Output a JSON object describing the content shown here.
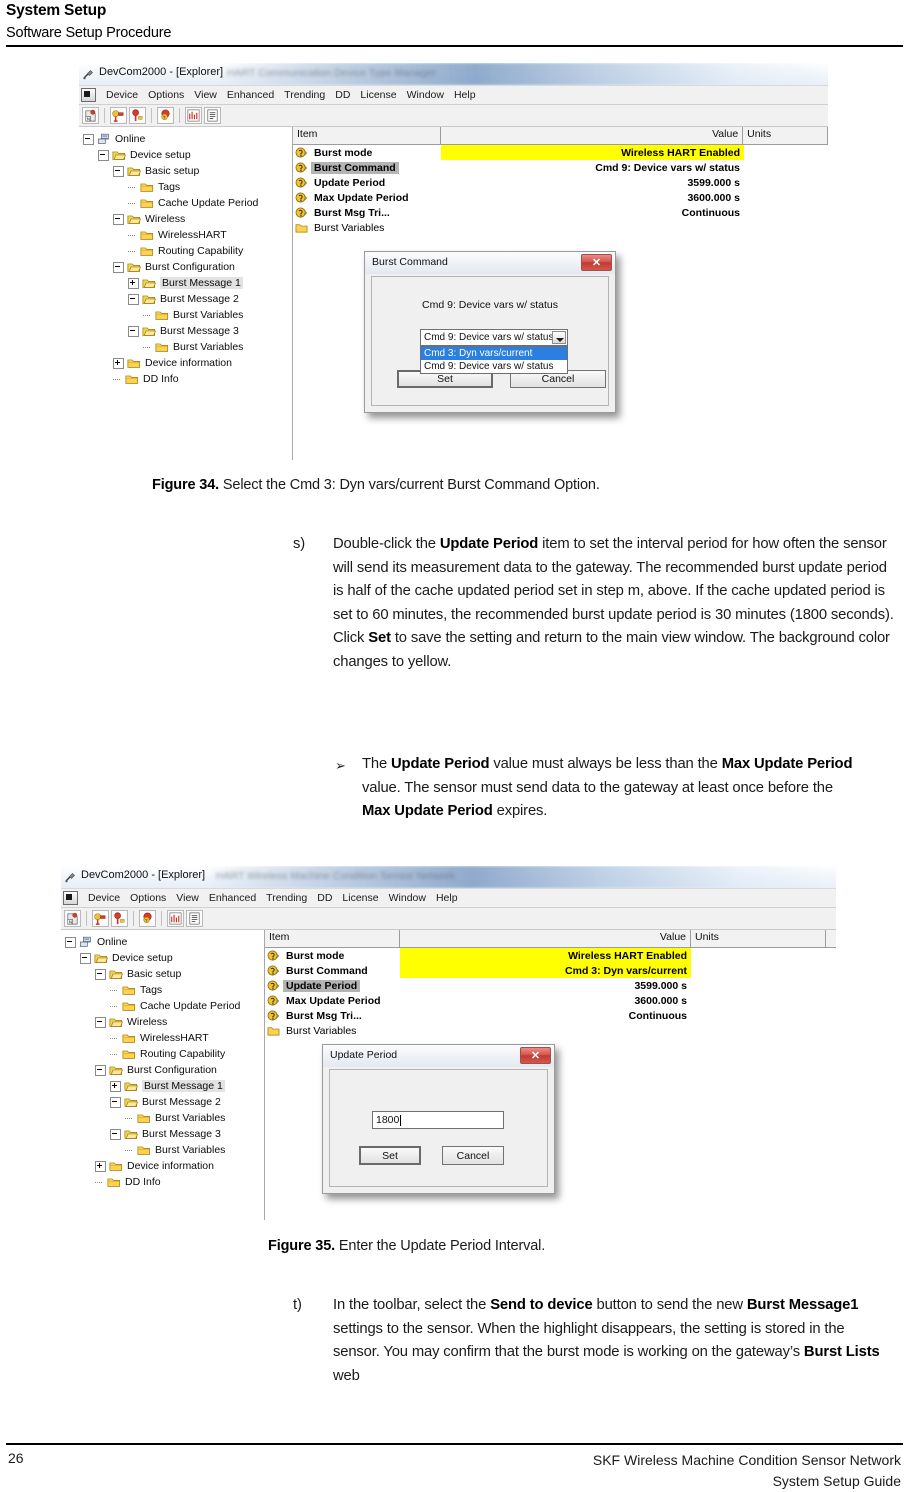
{
  "page_header": {
    "title": "System Setup",
    "subtitle": "Software Setup Procedure"
  },
  "figure34": {
    "window": {
      "title": "DevCom2000 - [Explorer]",
      "title_ghost": "HART Communication Device Type Manager",
      "menu": [
        "Device",
        "Options",
        "View",
        "Enhanced",
        "Trending",
        "DD",
        "License",
        "Window",
        "Help"
      ],
      "toolbar_icons": [
        "save-to-file-icon",
        "send-to-device-icon",
        "receive-from-device-icon",
        "device-status-icon",
        "chart-icon",
        "document-icon"
      ]
    },
    "tree": [
      {
        "label": "Online",
        "depth": 0,
        "toggle": "minus",
        "icon": "network-icon",
        "selected": false
      },
      {
        "label": "Device setup",
        "depth": 1,
        "toggle": "minus",
        "icon": "folder-open-icon",
        "selected": false
      },
      {
        "label": "Basic setup",
        "depth": 2,
        "toggle": "minus",
        "icon": "folder-open-icon",
        "selected": false
      },
      {
        "label": "Tags",
        "depth": 3,
        "toggle": "none",
        "icon": "folder-icon",
        "selected": false
      },
      {
        "label": "Cache Update Period",
        "depth": 3,
        "toggle": "none",
        "icon": "folder-icon",
        "selected": false
      },
      {
        "label": "Wireless",
        "depth": 2,
        "toggle": "minus",
        "icon": "folder-open-icon",
        "selected": false
      },
      {
        "label": "WirelessHART",
        "depth": 3,
        "toggle": "none",
        "icon": "folder-icon",
        "selected": false
      },
      {
        "label": "Routing Capability",
        "depth": 3,
        "toggle": "none",
        "icon": "folder-icon",
        "selected": false
      },
      {
        "label": "Burst Configuration",
        "depth": 2,
        "toggle": "minus",
        "icon": "folder-open-icon",
        "selected": false
      },
      {
        "label": "Burst Message 1",
        "depth": 3,
        "toggle": "plus",
        "icon": "folder-open-icon",
        "selected": true
      },
      {
        "label": "Burst Message 2",
        "depth": 3,
        "toggle": "minus",
        "icon": "folder-open-icon",
        "selected": false
      },
      {
        "label": "Burst Variables",
        "depth": 4,
        "toggle": "none",
        "icon": "folder-icon",
        "selected": false
      },
      {
        "label": "Burst Message 3",
        "depth": 3,
        "toggle": "minus",
        "icon": "folder-open-icon",
        "selected": false
      },
      {
        "label": "Burst Variables",
        "depth": 4,
        "toggle": "none",
        "icon": "folder-icon",
        "selected": false
      },
      {
        "label": "Device information",
        "depth": 2,
        "toggle": "plus",
        "icon": "folder-icon",
        "selected": false
      },
      {
        "label": "DD Info",
        "depth": 2,
        "toggle": "none",
        "icon": "folder-icon",
        "selected": false
      }
    ],
    "grid": {
      "columns": [
        "Item",
        "",
        "Value",
        "Units"
      ],
      "rows": [
        {
          "item": "Burst mode",
          "value": "Wireless HART Enabled",
          "units": "",
          "value_highlight": true,
          "item_selected": false,
          "icon": "variable-icon",
          "bold": true
        },
        {
          "item": "Burst Command",
          "value": "Cmd 9: Device vars w/ status",
          "units": "",
          "value_highlight": false,
          "item_selected": true,
          "icon": "variable-icon",
          "bold": true
        },
        {
          "item": "Update Period",
          "value": "3599.000 s",
          "units": "",
          "value_highlight": false,
          "item_selected": false,
          "icon": "variable-icon",
          "bold": true
        },
        {
          "item": "Max Update Period",
          "value": "3600.000 s",
          "units": "",
          "value_highlight": false,
          "item_selected": false,
          "icon": "variable-icon",
          "bold": true
        },
        {
          "item": "Burst Msg Tri...",
          "value": "Continuous",
          "units": "",
          "value_highlight": false,
          "item_selected": false,
          "icon": "variable-icon",
          "bold": true
        },
        {
          "item": "Burst Variables",
          "value": "",
          "units": "",
          "value_highlight": false,
          "item_selected": false,
          "icon": "folder-icon",
          "bold": false
        }
      ]
    },
    "dialog": {
      "title": "Burst Command",
      "close_label": "✕",
      "caption": "Cmd 9: Device vars w/ status",
      "combo_value": "Cmd 9: Device vars w/ status",
      "options": [
        {
          "label": "Cmd 3: Dyn vars/current",
          "highlighted": true
        },
        {
          "label": "Cmd 9: Device vars w/ status",
          "highlighted": false
        }
      ],
      "set_label": "Set",
      "cancel_label": "Cancel"
    },
    "caption_number": "Figure 34.",
    "caption_text": "Select the Cmd 3: Dyn vars/current Burst Command Option."
  },
  "step_s": {
    "marker": "s)",
    "segments": [
      {
        "t": "Double-click the ",
        "b": false
      },
      {
        "t": "Update Period",
        "b": true
      },
      {
        "t": " item to set the interval period for how often the sensor will send its measurement data to the gateway.  The recommended burst update period is half of the cache updated period set in step m, above.  If the cache updated period is set to 60 minutes, the recommended burst update period is 30 minutes (1800 seconds).  Click ",
        "b": false
      },
      {
        "t": "Set",
        "b": true
      },
      {
        "t": " to save the setting and return to the main view window.  The background color changes to yellow.",
        "b": false
      }
    ]
  },
  "step_s_note": {
    "bullet": "➢",
    "segments": [
      {
        "t": "The ",
        "b": false
      },
      {
        "t": "Update Period",
        "b": true
      },
      {
        "t": " value must always be less than the ",
        "b": false
      },
      {
        "t": "Max Update Period",
        "b": true
      },
      {
        "t": " value.  The sensor must send data to the gateway at least once before the ",
        "b": false
      },
      {
        "t": "Max Update Period",
        "b": true
      },
      {
        "t": " expires.",
        "b": false
      }
    ]
  },
  "figure35": {
    "window": {
      "title": "DevCom2000 - [Explorer]",
      "title_ghost": "HART Wireless Machine Condition Sensor Network",
      "menu": [
        "Device",
        "Options",
        "View",
        "Enhanced",
        "Trending",
        "DD",
        "License",
        "Window",
        "Help"
      ],
      "toolbar_icons": [
        "save-to-file-icon",
        "send-to-device-icon",
        "receive-from-device-icon",
        "device-status-icon",
        "chart-icon",
        "document-icon"
      ]
    },
    "tree": [
      {
        "label": "Online",
        "depth": 0,
        "toggle": "minus",
        "icon": "network-icon",
        "selected": false
      },
      {
        "label": "Device setup",
        "depth": 1,
        "toggle": "minus",
        "icon": "folder-open-icon",
        "selected": false
      },
      {
        "label": "Basic setup",
        "depth": 2,
        "toggle": "minus",
        "icon": "folder-open-icon",
        "selected": false
      },
      {
        "label": "Tags",
        "depth": 3,
        "toggle": "none",
        "icon": "folder-icon",
        "selected": false
      },
      {
        "label": "Cache Update Period",
        "depth": 3,
        "toggle": "none",
        "icon": "folder-icon",
        "selected": false
      },
      {
        "label": "Wireless",
        "depth": 2,
        "toggle": "minus",
        "icon": "folder-open-icon",
        "selected": false
      },
      {
        "label": "WirelessHART",
        "depth": 3,
        "toggle": "none",
        "icon": "folder-icon",
        "selected": false
      },
      {
        "label": "Routing Capability",
        "depth": 3,
        "toggle": "none",
        "icon": "folder-icon",
        "selected": false
      },
      {
        "label": "Burst Configuration",
        "depth": 2,
        "toggle": "minus",
        "icon": "folder-open-icon",
        "selected": false
      },
      {
        "label": "Burst Message 1",
        "depth": 3,
        "toggle": "plus",
        "icon": "folder-open-icon",
        "selected": true
      },
      {
        "label": "Burst Message 2",
        "depth": 3,
        "toggle": "minus",
        "icon": "folder-open-icon",
        "selected": false
      },
      {
        "label": "Burst Variables",
        "depth": 4,
        "toggle": "none",
        "icon": "folder-icon",
        "selected": false
      },
      {
        "label": "Burst Message 3",
        "depth": 3,
        "toggle": "minus",
        "icon": "folder-open-icon",
        "selected": false
      },
      {
        "label": "Burst Variables",
        "depth": 4,
        "toggle": "none",
        "icon": "folder-icon",
        "selected": false
      },
      {
        "label": "Device information",
        "depth": 2,
        "toggle": "plus",
        "icon": "folder-icon",
        "selected": false
      },
      {
        "label": "DD Info",
        "depth": 2,
        "toggle": "none",
        "icon": "folder-icon",
        "selected": false
      }
    ],
    "grid": {
      "columns": [
        "Item",
        "",
        "Value",
        "Units"
      ],
      "rows": [
        {
          "item": "Burst mode",
          "value": "Wireless HART Enabled",
          "units": "",
          "value_highlight": true,
          "item_selected": false,
          "icon": "variable-icon",
          "bold": true
        },
        {
          "item": "Burst Command",
          "value": "Cmd 3: Dyn vars/current",
          "units": "",
          "value_highlight": true,
          "item_selected": false,
          "icon": "variable-icon",
          "bold": true
        },
        {
          "item": "Update Period",
          "value": "3599.000 s",
          "units": "",
          "value_highlight": false,
          "item_selected": true,
          "icon": "variable-icon",
          "bold": true
        },
        {
          "item": "Max Update Period",
          "value": "3600.000 s",
          "units": "",
          "value_highlight": false,
          "item_selected": false,
          "icon": "variable-icon",
          "bold": true
        },
        {
          "item": "Burst Msg Tri...",
          "value": "Continuous",
          "units": "",
          "value_highlight": false,
          "item_selected": false,
          "icon": "variable-icon",
          "bold": true
        },
        {
          "item": "Burst Variables",
          "value": "",
          "units": "",
          "value_highlight": false,
          "item_selected": false,
          "icon": "folder-icon",
          "bold": false
        }
      ]
    },
    "dialog": {
      "title": "Update Period",
      "close_label": "✕",
      "input_value": "1800",
      "set_label": "Set",
      "cancel_label": "Cancel"
    },
    "caption_number": "Figure 35.",
    "caption_text": "Enter the Update Period Interval."
  },
  "step_t": {
    "marker": "t)",
    "segments": [
      {
        "t": "In the toolbar, select the ",
        "b": false
      },
      {
        "t": "Send to device",
        "b": true
      },
      {
        "t": " button to send the new ",
        "b": false
      },
      {
        "t": "Burst Message1",
        "b": true
      },
      {
        "t": " settings to the sensor.  When the highlight disappears, the setting is stored in the sensor.  You may confirm that the burst mode is working on the gateway’s ",
        "b": false
      },
      {
        "t": "Burst Lists",
        "b": true
      },
      {
        "t": " web",
        "b": false
      }
    ]
  },
  "footer": {
    "page_number": "26",
    "line1": "SKF Wireless Machine Condition Sensor Network",
    "line2": "System Setup Guide"
  },
  "colors": {
    "highlight_yellow": "#ffff00",
    "selection_gray": "#b4b4b4",
    "dropdown_blue": "#2a7fe0",
    "close_red": "#c03b33",
    "folder_yellow": "#ffd24d"
  }
}
